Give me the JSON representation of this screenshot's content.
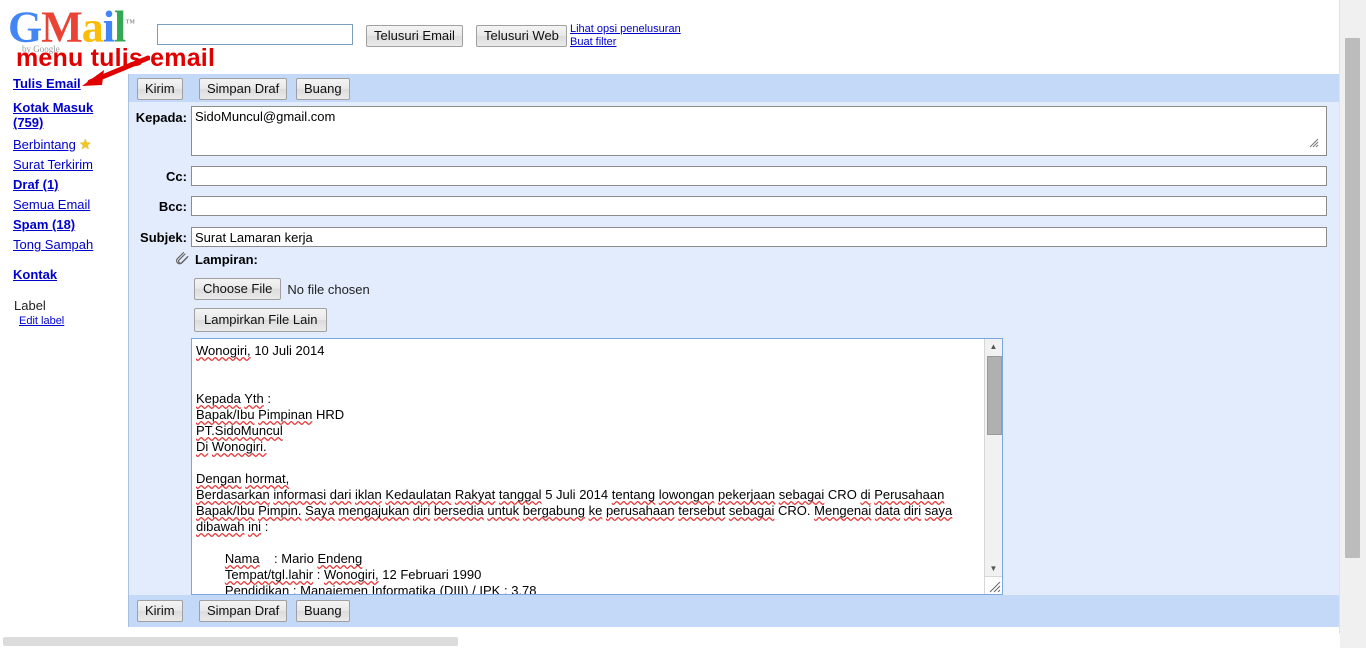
{
  "logo": {
    "letters": [
      "G",
      "M",
      "a",
      "i",
      "l"
    ],
    "trademark": "™",
    "subtext": "by Google"
  },
  "header": {
    "search_value": "",
    "search_placeholder": "",
    "btn_search_email": "Telusuri Email",
    "btn_search_web": "Telusuri Web",
    "link_search_options": "Lihat opsi penelusuran",
    "link_create_filter": "Buat filter"
  },
  "annotation": {
    "text": "menu tulis email",
    "color": "#e00000"
  },
  "sidebar": {
    "compose": "Tulis Email",
    "items": [
      {
        "label": "Kotak Masuk (759)"
      },
      {
        "label": "Berbintang"
      },
      {
        "label": "Surat Terkirim"
      },
      {
        "label": "Draf (1)"
      },
      {
        "label": "Semua Email"
      },
      {
        "label": "Spam (18)"
      },
      {
        "label": "Tong Sampah"
      },
      {
        "label": "Kontak"
      }
    ],
    "star_glyph": "★",
    "label_heading": "Label",
    "edit_label": "Edit label"
  },
  "toolbar": {
    "send": "Kirim",
    "save_draft": "Simpan Draf",
    "discard": "Buang"
  },
  "form": {
    "to_label": "Kepada:",
    "to_value": "SidoMuncul@gmail.com",
    "cc_label": "Cc:",
    "cc_value": "",
    "bcc_label": "Bcc:",
    "bcc_value": "",
    "subject_label": "Subjek:",
    "subject_value": "Surat Lamaran kerja",
    "attachment_label": "Lampiran:",
    "choose_file_button": "Choose File",
    "file_status": "No file chosen",
    "attach_other_button": "Lampirkan File Lain"
  },
  "body": {
    "text": "Wonogiri, 10 Juli 2014\n\n\nKepada Yth :\nBapak/Ibu Pimpinan HRD\nPT.SidoMuncul\nDi Wonogiri.\n\nDengan hormat,\nBerdasarkan informasi dari iklan Kedaulatan Rakyat tanggal 5 Juli 2014 tentang lowongan pekerjaan sebagai CRO di Perusahaan Bapak/Ibu Pimpin. Saya mengajukan diri bersedia untuk bergabung ke perusahaan tersebut sebagai CRO. Mengenai data diri saya dibawah ini :\n\n        Nama    : Mario Endeng\n        Tempat/tgl.lahir : Wonogiri, 12 Februari 1990\n        Pendidikan : Manajemen Informatika (DIII) / IPK : 3.78"
  },
  "colors": {
    "toolbar_blue": "#c3d9f7",
    "compose_bg": "#e3ecfd",
    "link_blue": "#0000cc",
    "annotation_red": "#e00000",
    "star_yellow": "#f5c518"
  }
}
